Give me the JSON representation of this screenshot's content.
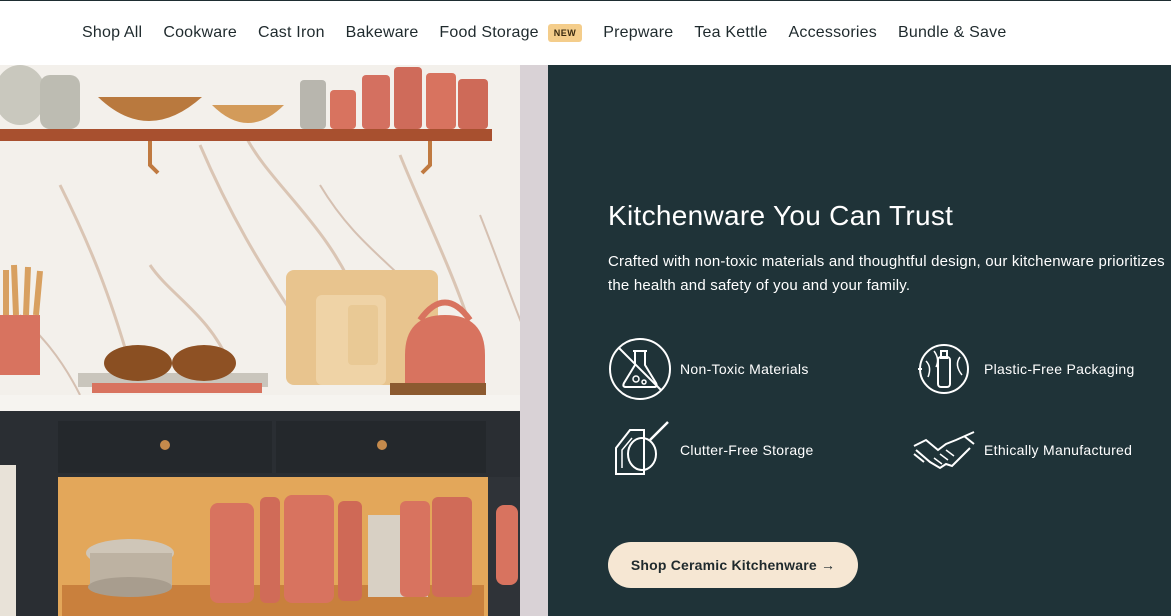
{
  "nav": {
    "items": [
      {
        "label": "Shop All"
      },
      {
        "label": "Cookware"
      },
      {
        "label": "Cast Iron"
      },
      {
        "label": "Bakeware"
      },
      {
        "label": "Food Storage",
        "badge": "NEW"
      },
      {
        "label": "Prepware"
      },
      {
        "label": "Tea Kettle"
      },
      {
        "label": "Accessories"
      },
      {
        "label": "Bundle & Save"
      }
    ]
  },
  "hero": {
    "title": "Kitchenware You Can Trust",
    "description": "Crafted with non-toxic materials and thoughtful design, our kitchenware prioritizes the health and safety of you and your family.",
    "features": [
      {
        "label": "Non-Toxic Materials",
        "icon": "no-toxic-flask-icon"
      },
      {
        "label": "Plastic-Free Packaging",
        "icon": "globe-bottle-icon"
      },
      {
        "label": "Clutter-Free Storage",
        "icon": "pan-storage-icon"
      },
      {
        "label": "Ethically Manufactured",
        "icon": "handshake-icon"
      }
    ],
    "cta_label": "Shop Ceramic Kitchenware →"
  },
  "colors": {
    "panel_bg": "#1f3338",
    "cta_bg": "#f6e7d3",
    "badge_bg": "#f4cd8b",
    "accent_terracotta": "#d8735f"
  }
}
